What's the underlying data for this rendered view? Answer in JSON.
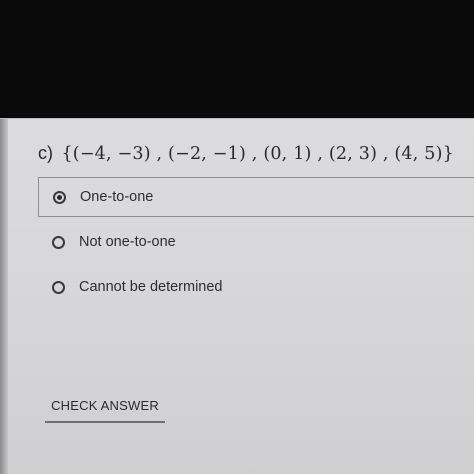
{
  "question": {
    "prefix": "c)",
    "set_text": "{(−4, −3) , (−2, −1) , (0, 1) , (2, 3) , (4, 5)}"
  },
  "options": [
    {
      "label": "One-to-one",
      "selected": true
    },
    {
      "label": "Not one-to-one",
      "selected": false
    },
    {
      "label": "Cannot be determined",
      "selected": false
    }
  ],
  "actions": {
    "check_answer_label": "CHECK ANSWER"
  }
}
